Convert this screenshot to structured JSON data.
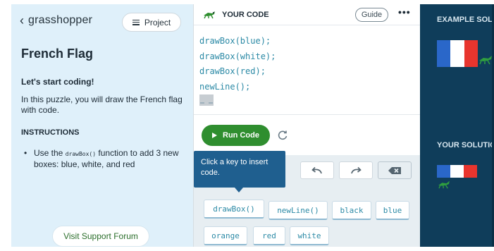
{
  "left_panel": {
    "back_label": "grasshopper",
    "project_label": "Project",
    "puzzle_title": "French Flag",
    "subhead": "Let's start coding!",
    "intro": "In this puzzle, you will draw the French flag with code.",
    "instructions_head": "INSTRUCTIONS",
    "bullet_prefix": "Use the ",
    "bullet_func": "drawBox()",
    "bullet_suffix": " function to add 3 new boxes: blue, white, and red",
    "support_label": "Visit Support Forum"
  },
  "code_panel": {
    "title": "YOUR CODE",
    "guide_label": "Guide",
    "more_label": "•••",
    "lines": [
      "drawBox(blue);",
      "drawBox(white);",
      "drawBox(red);",
      "newLine();"
    ],
    "run_label": "Run Code"
  },
  "keyboard": {
    "tooltip": "Click a key to insert code.",
    "keys_row1": [
      "drawBox()",
      "newLine()",
      "black",
      "blue"
    ],
    "keys_row2": [
      "orange",
      "red",
      "white"
    ]
  },
  "right_panel": {
    "example_label": "EXAMPLE SOLUTION",
    "your_label": "YOUR SOLUTION"
  },
  "colors": {
    "flag_blue": "#2a67c9",
    "flag_white": "#ffffff",
    "flag_red": "#e8352e",
    "run_green": "#2f8e2f",
    "panel_navy": "#0f3d5a"
  }
}
